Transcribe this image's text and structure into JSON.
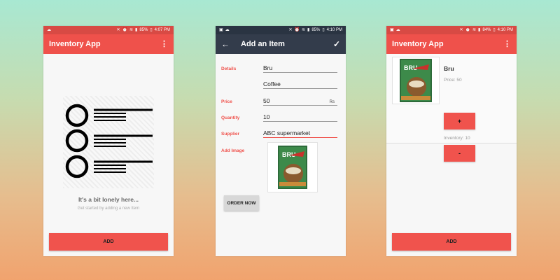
{
  "status_bars": [
    {
      "battery": "85%",
      "time": "4:07 PM"
    },
    {
      "battery": "85%",
      "time": "4:10 PM"
    },
    {
      "battery": "84%",
      "time": "4:10 PM"
    }
  ],
  "screen_list_empty": {
    "title": "Inventory App",
    "empty_title": "It's a bit lonely here...",
    "empty_subtitle": "Get started by adding a new Item",
    "add_label": "ADD"
  },
  "screen_add_item": {
    "title": "Add an Item",
    "labels": {
      "details": "Details",
      "price": "Price",
      "quantity": "Quantity",
      "supplier": "Supplier",
      "add_image": "Add Image"
    },
    "values": {
      "name": "Bru",
      "type": "Coffee",
      "price": "50",
      "price_unit": "Rs",
      "quantity": "10",
      "supplier": "ABC supermarket"
    },
    "order_label": "ORDER NOW"
  },
  "screen_list_item": {
    "title": "Inventory App",
    "item": {
      "name": "Bru",
      "price_text": "Price: 50",
      "inventory_text": "Inventory: 10",
      "plus_label": "+",
      "minus_label": "-"
    },
    "add_label": "ADD"
  },
  "colors": {
    "accent": "#EF514B",
    "toolbar_dark": "#333C4B",
    "background_top": "#A8E8D2",
    "background_bottom": "#F1A36E"
  },
  "icons": [
    "cloud-icon",
    "mute-icon",
    "alarm-icon",
    "wifi-icon",
    "signal-icon",
    "battery-icon",
    "overflow-menu-icon",
    "back-arrow-icon",
    "check-icon",
    "list-illustration"
  ]
}
